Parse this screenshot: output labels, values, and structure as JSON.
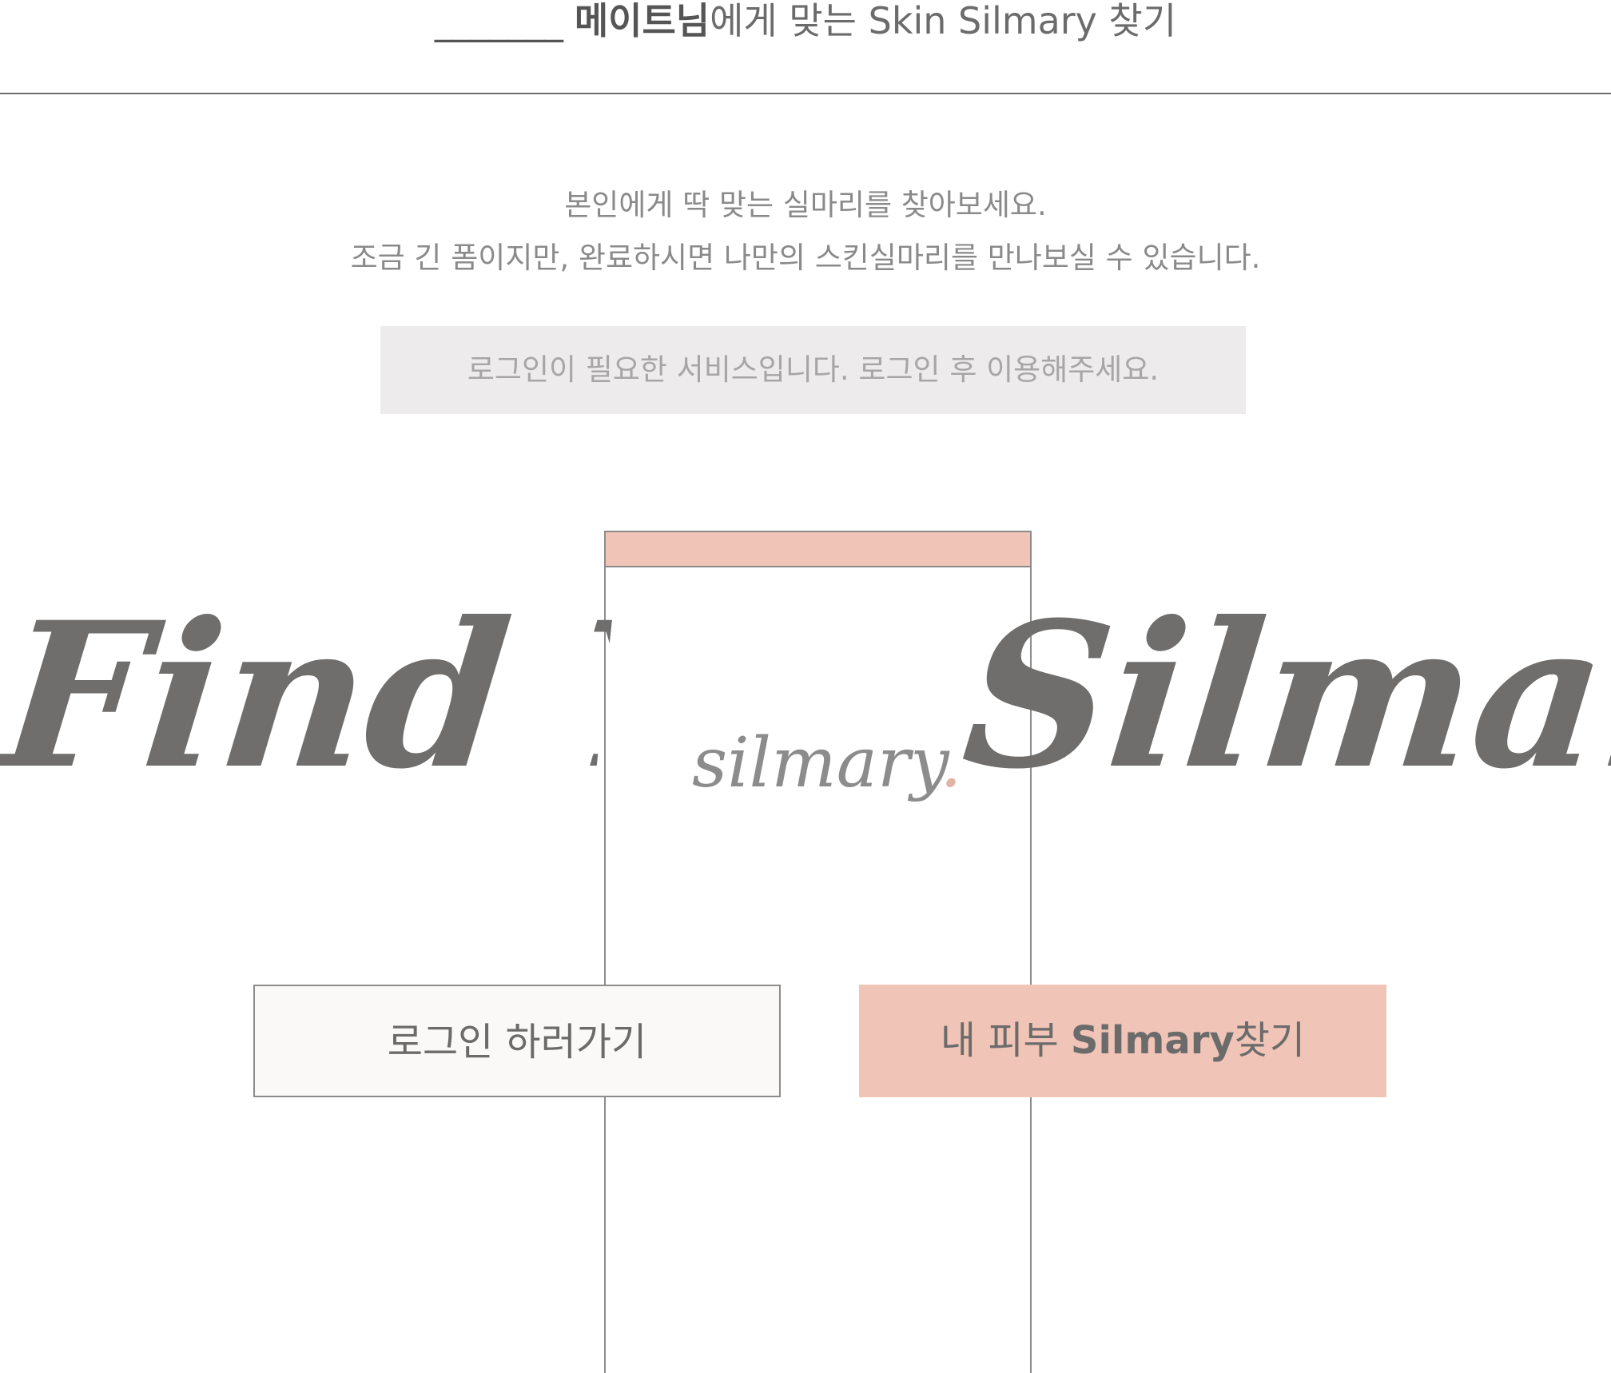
{
  "header": {
    "blank": "_______",
    "user_name": "메이트님",
    "title_rest": "에게 맞는 Skin Silmary 찾기"
  },
  "intro": {
    "line1": "본인에게 딱 맞는 실마리를 찾아보세요.",
    "line2": "조금 긴 폼이지만, 완료하시면 나만의 스킨실마리를 만나보실 수 있습니다."
  },
  "notice": {
    "text": "로그인이 필요한 서비스입니다. 로그인 후 이용해주세요."
  },
  "hero": {
    "left_script": "Find You",
    "right_script": "Silmary",
    "logo_text": "silmary",
    "logo_dot": ".",
    "colors": {
      "accent": "#f0c4b6",
      "script": "#6f6e6c",
      "text": "#6b6b6b"
    }
  },
  "buttons": {
    "login_label": "로그인 하러가기",
    "find_prefix": "내 피부 ",
    "find_bold": "Silmary",
    "find_suffix": "찾기"
  }
}
